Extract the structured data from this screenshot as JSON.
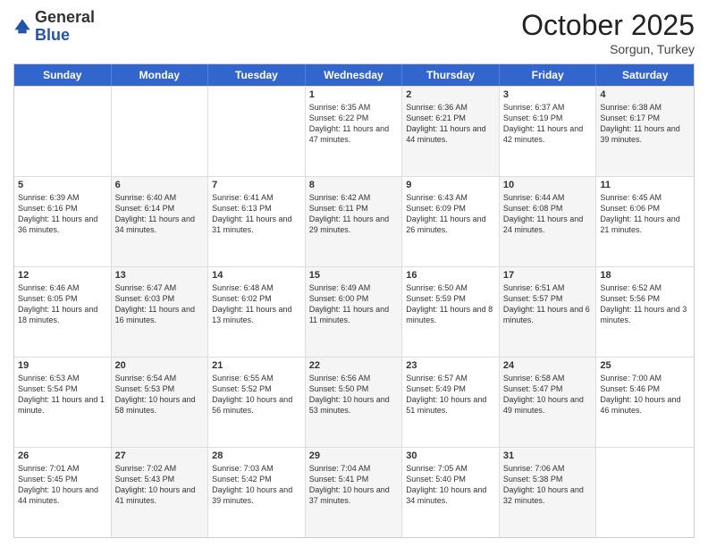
{
  "header": {
    "logo_general": "General",
    "logo_blue": "Blue",
    "month": "October 2025",
    "location": "Sorgun, Turkey"
  },
  "days_of_week": [
    "Sunday",
    "Monday",
    "Tuesday",
    "Wednesday",
    "Thursday",
    "Friday",
    "Saturday"
  ],
  "weeks": [
    [
      {
        "day": "",
        "text": "",
        "shaded": false,
        "empty": true
      },
      {
        "day": "",
        "text": "",
        "shaded": false,
        "empty": true
      },
      {
        "day": "",
        "text": "",
        "shaded": false,
        "empty": true
      },
      {
        "day": "1",
        "text": "Sunrise: 6:35 AM\nSunset: 6:22 PM\nDaylight: 11 hours and 47 minutes.",
        "shaded": false
      },
      {
        "day": "2",
        "text": "Sunrise: 6:36 AM\nSunset: 6:21 PM\nDaylight: 11 hours and 44 minutes.",
        "shaded": true
      },
      {
        "day": "3",
        "text": "Sunrise: 6:37 AM\nSunset: 6:19 PM\nDaylight: 11 hours and 42 minutes.",
        "shaded": false
      },
      {
        "day": "4",
        "text": "Sunrise: 6:38 AM\nSunset: 6:17 PM\nDaylight: 11 hours and 39 minutes.",
        "shaded": true
      }
    ],
    [
      {
        "day": "5",
        "text": "Sunrise: 6:39 AM\nSunset: 6:16 PM\nDaylight: 11 hours and 36 minutes.",
        "shaded": false
      },
      {
        "day": "6",
        "text": "Sunrise: 6:40 AM\nSunset: 6:14 PM\nDaylight: 11 hours and 34 minutes.",
        "shaded": true
      },
      {
        "day": "7",
        "text": "Sunrise: 6:41 AM\nSunset: 6:13 PM\nDaylight: 11 hours and 31 minutes.",
        "shaded": false
      },
      {
        "day": "8",
        "text": "Sunrise: 6:42 AM\nSunset: 6:11 PM\nDaylight: 11 hours and 29 minutes.",
        "shaded": true
      },
      {
        "day": "9",
        "text": "Sunrise: 6:43 AM\nSunset: 6:09 PM\nDaylight: 11 hours and 26 minutes.",
        "shaded": false
      },
      {
        "day": "10",
        "text": "Sunrise: 6:44 AM\nSunset: 6:08 PM\nDaylight: 11 hours and 24 minutes.",
        "shaded": true
      },
      {
        "day": "11",
        "text": "Sunrise: 6:45 AM\nSunset: 6:06 PM\nDaylight: 11 hours and 21 minutes.",
        "shaded": false
      }
    ],
    [
      {
        "day": "12",
        "text": "Sunrise: 6:46 AM\nSunset: 6:05 PM\nDaylight: 11 hours and 18 minutes.",
        "shaded": false
      },
      {
        "day": "13",
        "text": "Sunrise: 6:47 AM\nSunset: 6:03 PM\nDaylight: 11 hours and 16 minutes.",
        "shaded": true
      },
      {
        "day": "14",
        "text": "Sunrise: 6:48 AM\nSunset: 6:02 PM\nDaylight: 11 hours and 13 minutes.",
        "shaded": false
      },
      {
        "day": "15",
        "text": "Sunrise: 6:49 AM\nSunset: 6:00 PM\nDaylight: 11 hours and 11 minutes.",
        "shaded": true
      },
      {
        "day": "16",
        "text": "Sunrise: 6:50 AM\nSunset: 5:59 PM\nDaylight: 11 hours and 8 minutes.",
        "shaded": false
      },
      {
        "day": "17",
        "text": "Sunrise: 6:51 AM\nSunset: 5:57 PM\nDaylight: 11 hours and 6 minutes.",
        "shaded": true
      },
      {
        "day": "18",
        "text": "Sunrise: 6:52 AM\nSunset: 5:56 PM\nDaylight: 11 hours and 3 minutes.",
        "shaded": false
      }
    ],
    [
      {
        "day": "19",
        "text": "Sunrise: 6:53 AM\nSunset: 5:54 PM\nDaylight: 11 hours and 1 minute.",
        "shaded": false
      },
      {
        "day": "20",
        "text": "Sunrise: 6:54 AM\nSunset: 5:53 PM\nDaylight: 10 hours and 58 minutes.",
        "shaded": true
      },
      {
        "day": "21",
        "text": "Sunrise: 6:55 AM\nSunset: 5:52 PM\nDaylight: 10 hours and 56 minutes.",
        "shaded": false
      },
      {
        "day": "22",
        "text": "Sunrise: 6:56 AM\nSunset: 5:50 PM\nDaylight: 10 hours and 53 minutes.",
        "shaded": true
      },
      {
        "day": "23",
        "text": "Sunrise: 6:57 AM\nSunset: 5:49 PM\nDaylight: 10 hours and 51 minutes.",
        "shaded": false
      },
      {
        "day": "24",
        "text": "Sunrise: 6:58 AM\nSunset: 5:47 PM\nDaylight: 10 hours and 49 minutes.",
        "shaded": true
      },
      {
        "day": "25",
        "text": "Sunrise: 7:00 AM\nSunset: 5:46 PM\nDaylight: 10 hours and 46 minutes.",
        "shaded": false
      }
    ],
    [
      {
        "day": "26",
        "text": "Sunrise: 7:01 AM\nSunset: 5:45 PM\nDaylight: 10 hours and 44 minutes.",
        "shaded": false
      },
      {
        "day": "27",
        "text": "Sunrise: 7:02 AM\nSunset: 5:43 PM\nDaylight: 10 hours and 41 minutes.",
        "shaded": true
      },
      {
        "day": "28",
        "text": "Sunrise: 7:03 AM\nSunset: 5:42 PM\nDaylight: 10 hours and 39 minutes.",
        "shaded": false
      },
      {
        "day": "29",
        "text": "Sunrise: 7:04 AM\nSunset: 5:41 PM\nDaylight: 10 hours and 37 minutes.",
        "shaded": true
      },
      {
        "day": "30",
        "text": "Sunrise: 7:05 AM\nSunset: 5:40 PM\nDaylight: 10 hours and 34 minutes.",
        "shaded": false
      },
      {
        "day": "31",
        "text": "Sunrise: 7:06 AM\nSunset: 5:38 PM\nDaylight: 10 hours and 32 minutes.",
        "shaded": true
      },
      {
        "day": "",
        "text": "",
        "shaded": false,
        "empty": true
      }
    ]
  ]
}
